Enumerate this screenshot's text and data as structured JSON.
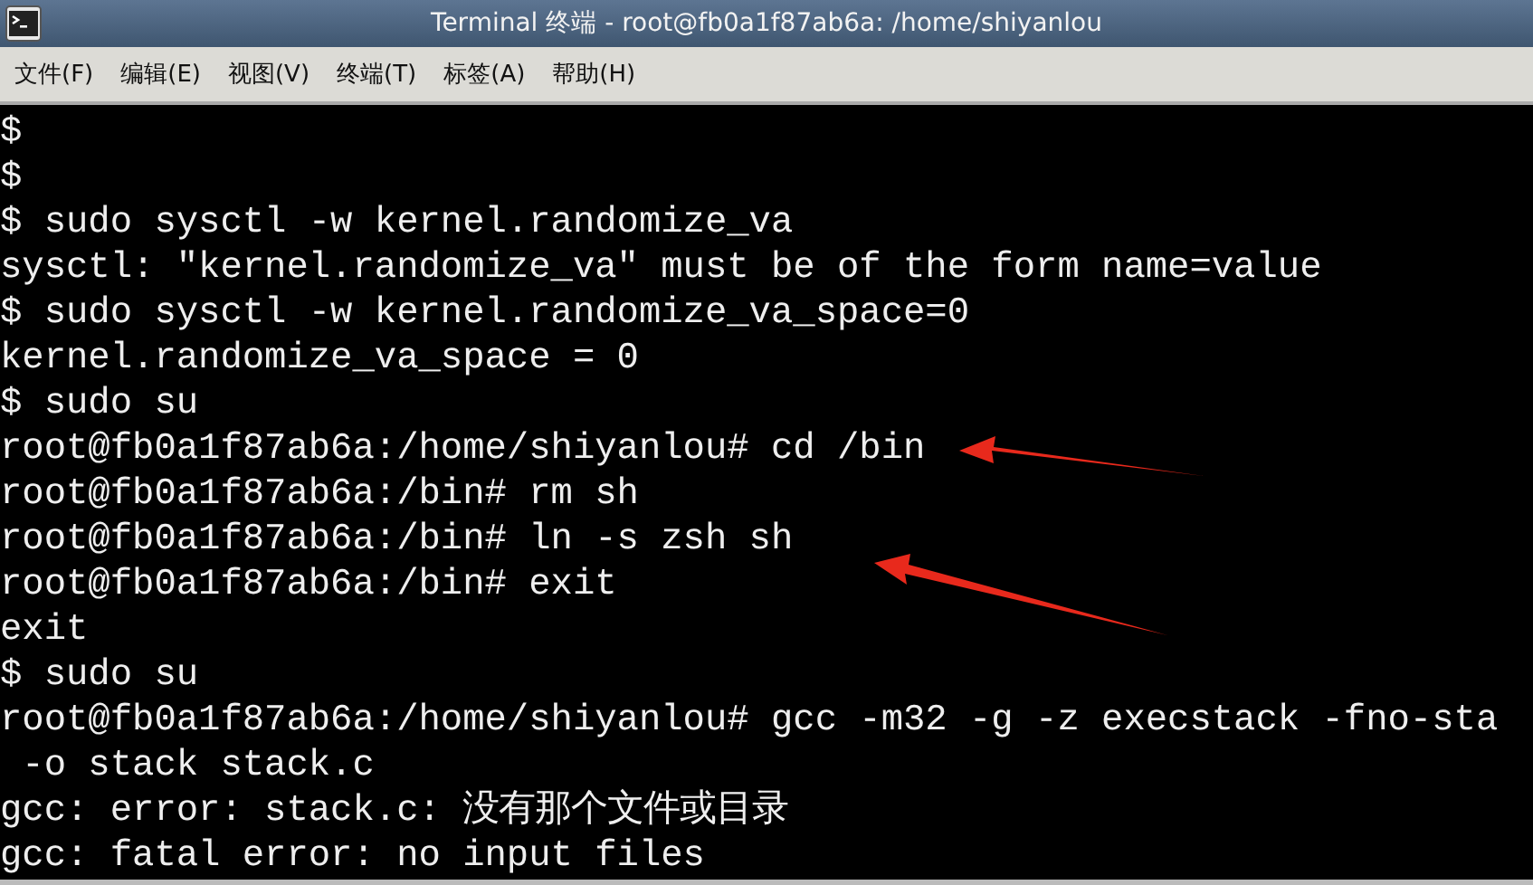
{
  "window": {
    "title": "Terminal 终端 - root@fb0a1f87ab6a: /home/shiyanlou"
  },
  "menu": [
    "文件(F)",
    "编辑(E)",
    "视图(V)",
    "终端(T)",
    "标签(A)",
    "帮助(H)"
  ],
  "terminal": {
    "lines": [
      "$",
      "$",
      "$ sudo sysctl -w kernel.randomize_va",
      "sysctl: \"kernel.randomize_va\" must be of the form name=value",
      "$ sudo sysctl -w kernel.randomize_va_space=0",
      "kernel.randomize_va_space = 0",
      "$ sudo su",
      "root@fb0a1f87ab6a:/home/shiyanlou# cd /bin",
      "root@fb0a1f87ab6a:/bin# rm sh",
      "root@fb0a1f87ab6a:/bin# ln -s zsh sh",
      "root@fb0a1f87ab6a:/bin# exit",
      "exit",
      "$ sudo su",
      "root@fb0a1f87ab6a:/home/shiyanlou# gcc -m32 -g -z execstack -fno-sta",
      " -o stack stack.c",
      "gcc: error: stack.c: 没有那个文件或目录",
      "gcc: fatal error: no input files"
    ]
  }
}
